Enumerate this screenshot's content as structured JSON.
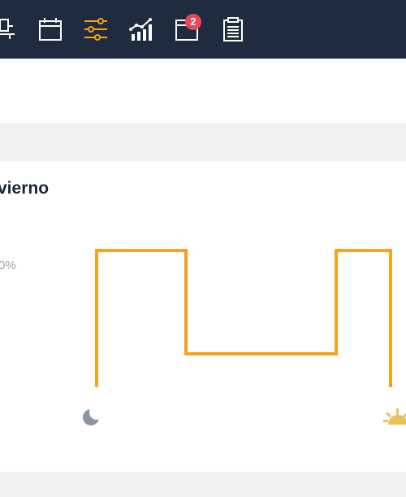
{
  "nav": {
    "items": [
      {
        "icon": "desk-person-icon",
        "active": false
      },
      {
        "icon": "calendar-icon",
        "active": false
      },
      {
        "icon": "sliders-icon",
        "active": true
      },
      {
        "icon": "chart-trend-icon",
        "active": false
      },
      {
        "icon": "inbox-icon",
        "active": false,
        "badge": "2"
      },
      {
        "icon": "clipboard-icon",
        "active": false
      }
    ],
    "active_color": "#f7a21b",
    "icon_color": "#ffffff",
    "background": "#1f2b3e"
  },
  "panel": {
    "title": "vierno",
    "axis_label": "0%"
  },
  "chart_data": {
    "type": "line",
    "x_start_icon": "moon-icon",
    "x_end_icon": "sunrise-icon",
    "line_color": "#f7a21b",
    "series": [
      {
        "values": [
          "low",
          "high",
          "mid",
          "high",
          "low"
        ]
      }
    ]
  }
}
